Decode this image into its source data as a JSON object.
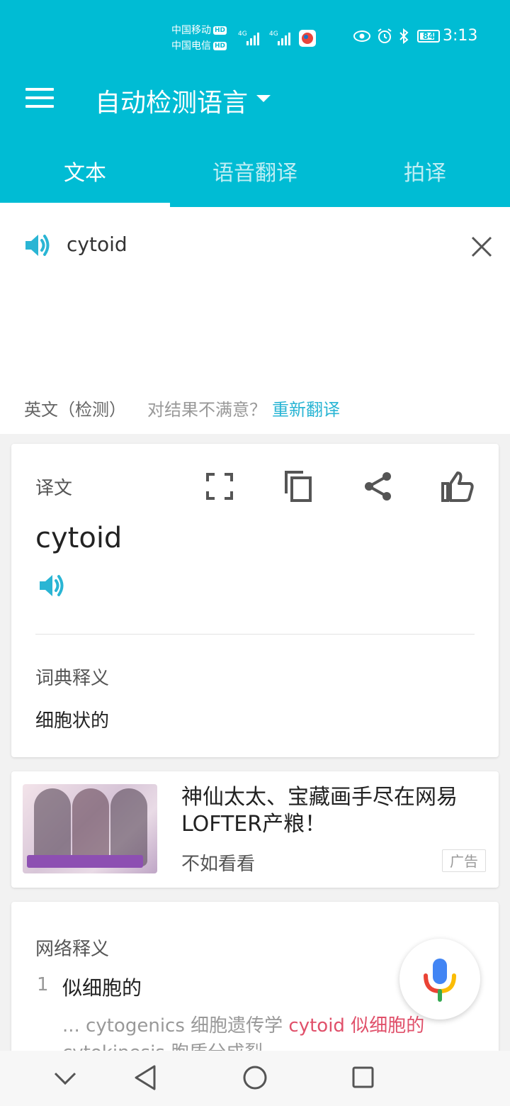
{
  "status_bar": {
    "carrier1": "中国移动",
    "carrier2": "中国电信",
    "hd": "HD",
    "net": "4G",
    "battery": "84",
    "battery_level": 0.84,
    "time": "3:13"
  },
  "header": {
    "language": "自动检测语言",
    "tabs": [
      "文本",
      "语音翻译",
      "拍译"
    ],
    "active_tab": 0
  },
  "input": {
    "text": "cytoid",
    "detected": "英文（检测）",
    "unsatisfied": "对结果不满意？",
    "retranslate": "重新翻译"
  },
  "translation": {
    "label": "译文",
    "result": "cytoid",
    "dict_label": "词典释义",
    "dict_value": "细胞状的"
  },
  "ad": {
    "title": "神仙太太、宝藏画手尽在网易LOFTER产粮！",
    "subtitle": "不如看看",
    "badge": "广告"
  },
  "web": {
    "label": "网络释义",
    "index": "1",
    "term": "似细胞的",
    "example_prefix": "... cytogenics 细胞遗传学 ",
    "example_highlight": "cytoid 似细胞的",
    "example_line2": "cytokinesis 胞质分成裂"
  },
  "colors": {
    "accent": "#00bcd4",
    "link": "#2ab5d4",
    "highlight": "#e0506a"
  }
}
